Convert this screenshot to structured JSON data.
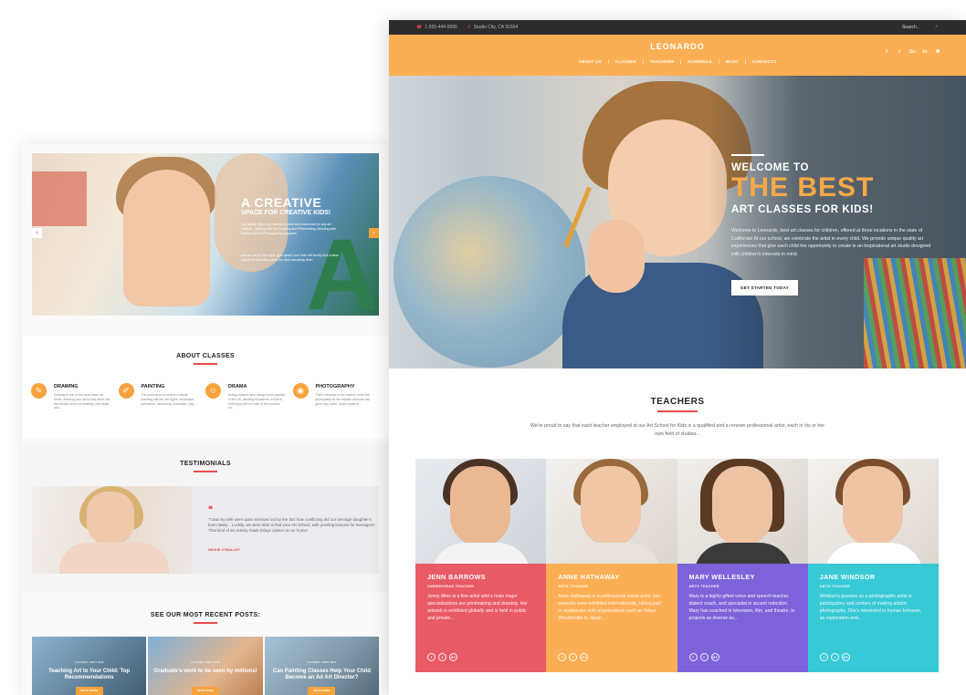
{
  "colors": {
    "accent_orange": "#fcae54",
    "accent_red": "#e94c4c",
    "topbar": "#2c2c2c",
    "teacher_cards": [
      "#e85a65",
      "#fcae54",
      "#7c63d9",
      "#38c9d6"
    ]
  },
  "back_page": {
    "hero": {
      "title": "A CREATIVE",
      "subtitle": "SPACE FOR CREATIVE KIDS!",
      "para1": "Our facility offers an extensive place and resources for any art classes - starting with the Drawing and Printmaking, finishing with Drama and Art Photography programs.",
      "para2": "Across our 20,000 sq.ft. gym space your kids will surely find a ideal space for spending some fun and educating time!",
      "arrow_left": "‹",
      "arrow_right": "›"
    },
    "about": {
      "title": "ABOUT CLASSES",
      "items": [
        {
          "icon": "pencil-icon",
          "glyph": "✎",
          "name": "DRAWING",
          "desc": "Drawing is one of the most basic art forms, allowing your kid to fully delve into the tranquil world of creativity, new skills and..."
        },
        {
          "icon": "brush-icon",
          "glyph": "✐",
          "name": "PAINTING",
          "desc": "The curriculum is varied to include teaching still-life, the figure, landscape, portraiture, cartooning, animation, clay..."
        },
        {
          "icon": "masks-icon",
          "glyph": "☺",
          "name": "DRAMA",
          "desc": "Acting classes have always been popular in the US, allowing thousands of kids to both enjoy the fun side of the process on..."
        },
        {
          "icon": "camera-icon",
          "glyph": "◉",
          "name": "PHOTOGRAPHY",
          "desc": "That's because in the modern world the pricequality for the regular cameras has gone way down. Much easier to..."
        }
      ]
    },
    "testimonials": {
      "title": "TESTIMONIALS",
      "quote_mark": "❝",
      "text": "\"I and my wife were quite stressed out by the fact how conflicting did our teenage daughter's been lately... Luckily, we were able to find your Art School, with painting lessons for teenagers! That kind of an activity made things calmer at our home!",
      "author": "NICKIE O'MALLEY"
    },
    "posts": {
      "title": "SEE OUR MOST RECENT POSTS:",
      "items": [
        {
          "meta": "CLASSES  •  SEPT 2016",
          "title": "Teaching Art to Your Child: Top Recommendations",
          "button": "READ MORE"
        },
        {
          "meta": "CLASSES  •  SEPT 2016",
          "title": "Graduate's work to be seen by millions!",
          "button": "READ MORE"
        },
        {
          "meta": "CLASSES  •  SEPT 2016",
          "title": "Can Painting Classes Help Your Child Become an Ad Art Director?",
          "button": "READ MORE"
        }
      ]
    }
  },
  "front_page": {
    "topbar": {
      "phone": "1-555-444-5566",
      "address": "Studio City, CA 91604",
      "search_placeholder": "Search..."
    },
    "header": {
      "logo": "LEONARDO",
      "menu": [
        "ABOUT US",
        "CLASSES",
        "TEACHERS",
        "SCHEDULE",
        "BLOG",
        "CONTACTS"
      ],
      "socials": [
        {
          "name": "facebook-icon",
          "glyph": "f"
        },
        {
          "name": "twitter-icon",
          "glyph": "t"
        },
        {
          "name": "google-plus-icon",
          "glyph": "G+"
        },
        {
          "name": "linkedin-icon",
          "glyph": "in"
        },
        {
          "name": "settings-icon",
          "glyph": "✱"
        }
      ]
    },
    "hero": {
      "line1": "WELCOME TO",
      "line2": "THE BEST",
      "line3": "ART CLASSES FOR KIDS!",
      "description": "Welcome to Leonardo, best art classes for children, offered at three locations in the state of California! At our school, we celebrate the artist in every child. We provide unique quality art experiences that give each child the opportunity to create in an inspirational art studio designed with children's interests in mind.",
      "cta": "GET STARTED TODAY"
    },
    "teachers": {
      "title": "TEACHERS",
      "intro": "We're proud to say that each teacher employed at our Art School for Kids is a qualified and a renown professional artist, each in his or her own field of studies...",
      "items": [
        {
          "name": "JENN BARROWS",
          "role": "OWNER/HEAD TEACHER",
          "bio": "Jenny Allen is a fine artist who's main major specializations are printmaking and drawing. Her artwork is exhibited globally and is held in public and private..."
        },
        {
          "name": "ANNE HATHAWAY",
          "role": "ARTS TEACHER",
          "bio": "Anne Hathaway is a professional visual artist. Her artworks were exhibited internationally, taking part in residencies with organizations such as Tokyo Wonderstite in Japan..."
        },
        {
          "name": "MARY WELLESLEY",
          "role": "ARTS TEACHER",
          "bio": "Mary is a highly gifted voice and speech teacher, dialect coach, and specialist in accent reduction. Mary has coached in television, film, and theatre, in projects as diverse as..."
        },
        {
          "name": "JANE WINDSOR",
          "role": "ARTS TEACHER",
          "bio": "Windsor's practice as a photographic artist is participatory and centers of making artistic photography. She's interested in human behavior, an exploration and..."
        }
      ],
      "social_glyphs": [
        "f",
        "t",
        "G+"
      ]
    }
  }
}
